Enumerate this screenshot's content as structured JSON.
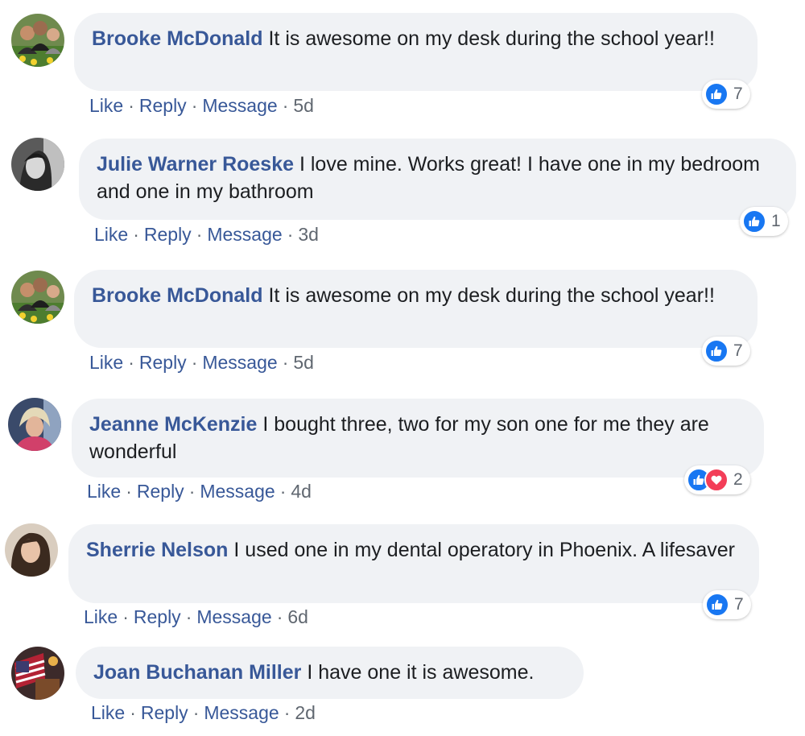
{
  "colors": {
    "link": "#385898",
    "bubble_bg": "#f0f2f5",
    "meta": "#606770",
    "like_blue": "#1877f2",
    "love_red": "#f33e58"
  },
  "icons": {
    "like": "thumbs-up-icon",
    "love": "heart-icon"
  },
  "comments": [
    {
      "author": "Brooke McDonald",
      "text": "It is awesome on my desk during the school year!!",
      "actions": {
        "like": "Like",
        "reply": "Reply",
        "message": "Message",
        "time": "5d"
      },
      "reaction_count": "7",
      "reactions": [
        "like"
      ]
    },
    {
      "author": "Julie Warner Roeske",
      "text": "I love mine. Works great! I have one in my bedroom and one in my bathroom",
      "actions": {
        "like": "Like",
        "reply": "Reply",
        "message": "Message",
        "time": "3d"
      },
      "reaction_count": "1",
      "reactions": [
        "like"
      ]
    },
    {
      "author": "Brooke McDonald",
      "text": "It is awesome on my desk during the school year!!",
      "actions": {
        "like": "Like",
        "reply": "Reply",
        "message": "Message",
        "time": "5d"
      },
      "reaction_count": "7",
      "reactions": [
        "like"
      ]
    },
    {
      "author": "Jeanne McKenzie",
      "text": "I bought three, two for my son one for me they are wonderful",
      "actions": {
        "like": "Like",
        "reply": "Reply",
        "message": "Message",
        "time": "4d"
      },
      "reaction_count": "2",
      "reactions": [
        "like",
        "love"
      ]
    },
    {
      "author": "Sherrie Nelson",
      "text": "I used one in my dental operatory in Phoenix. A lifesaver",
      "actions": {
        "like": "Like",
        "reply": "Reply",
        "message": "Message",
        "time": "6d"
      },
      "reaction_count": "7",
      "reactions": [
        "like"
      ]
    },
    {
      "author": "Joan Buchanan Miller",
      "text": "I have one it is awesome.",
      "actions": {
        "like": "Like",
        "reply": "Reply",
        "message": "Message",
        "time": "2d"
      }
    }
  ]
}
